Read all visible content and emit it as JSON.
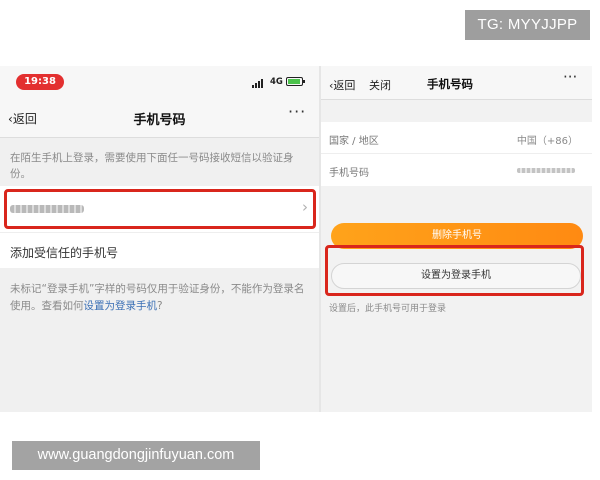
{
  "watermark": {
    "top": "TG: MYYJJPP",
    "bottom": "www.guangdongjinfuyuan.com"
  },
  "left_screen": {
    "status": {
      "time": "19:38",
      "network": "4G",
      "time_color": "#e33030",
      "battery_color": "#4cc34c"
    },
    "navbar": {
      "back_label": "返回",
      "title": "手机号码",
      "more": "···"
    },
    "hint_top": "在陌生手机上登录，需要使用下面任一号码接收短信以验证身份。",
    "phone_row": {
      "arrow": "›"
    },
    "add_trusted_label": "添加受信任的手机号",
    "hint_bottom_before": "未标记“登录手机”字样的号码仅用于验证身份，不能作为登录名使用。查看如何",
    "hint_bottom_link": "设置为登录手机",
    "hint_bottom_after": "?"
  },
  "right_screen": {
    "navbar": {
      "back_label": "返回",
      "close_label": "关闭",
      "title": "手机号码",
      "more": "···"
    },
    "region_label": "国家 / 地区",
    "region_value": "中国（+86）",
    "phone_label": "手机号码",
    "delete_button": "删除手机号",
    "set_login_button": "设置为登录手机",
    "note": "设置后，此手机号可用于登录",
    "accent_color": "#ff9a16"
  },
  "highlight_color": "#d9261c"
}
